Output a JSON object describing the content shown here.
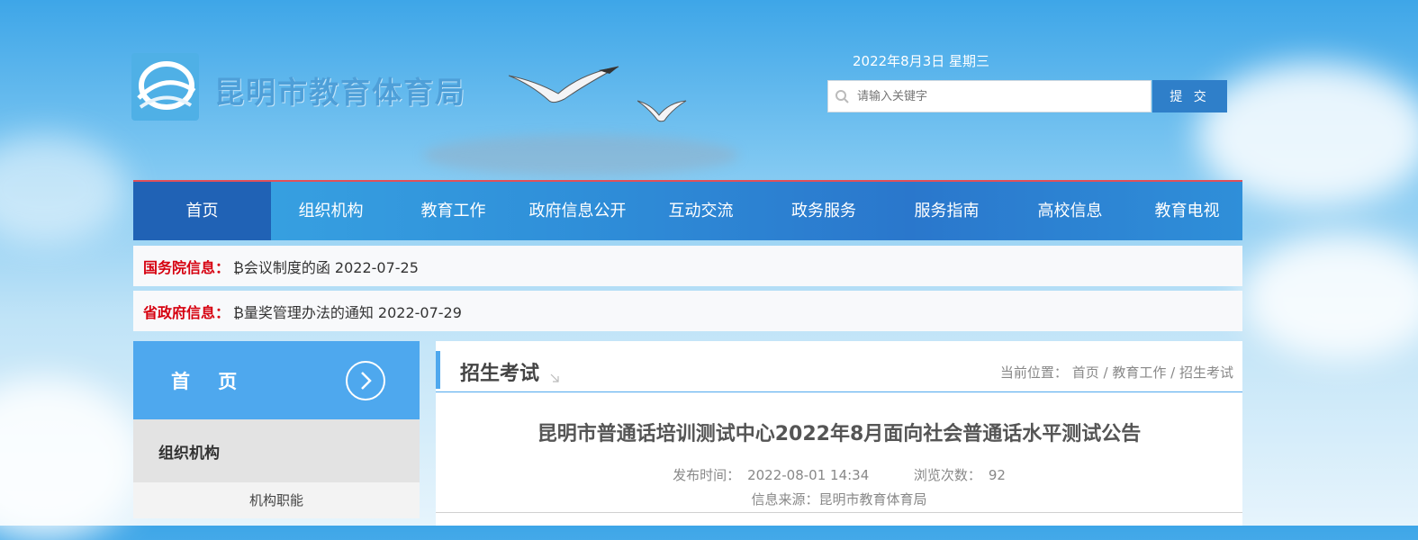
{
  "header": {
    "site_title": "昆明市教育体育局",
    "date": "2022年8月3日 星期三",
    "search": {
      "placeholder": "请输入关键字",
      "submit_label": "提 交"
    }
  },
  "nav": {
    "items": [
      {
        "label": "首页",
        "active": true
      },
      {
        "label": "组织机构"
      },
      {
        "label": "教育工作"
      },
      {
        "label": "政府信息公开"
      },
      {
        "label": "互动交流"
      },
      {
        "label": "政务服务"
      },
      {
        "label": "服务指南"
      },
      {
        "label": "高校信息"
      },
      {
        "label": "教育电视"
      }
    ]
  },
  "info_bars": [
    {
      "label": "国务院信息：",
      "text": "₿会议制度的函  2022-07-25"
    },
    {
      "label": "省政府信息：",
      "text": "₿量奖管理办法的通知  2022-07-29"
    }
  ],
  "sidebar": {
    "home_label": "首 页",
    "section_label": "组织机构",
    "sub_items": [
      "机构职能"
    ]
  },
  "main": {
    "section_title": "招生考试",
    "breadcrumb": {
      "prefix": "当前位置：",
      "items": [
        "首页",
        "教育工作",
        "招生考试"
      ],
      "sep": "/"
    },
    "article": {
      "title": "昆明市普通话培训测试中心2022年8月面向社会普通话水平测试公告",
      "publish_label": "发布时间：",
      "publish_time": "2022-08-01 14:34",
      "views_label": "浏览次数：",
      "views": "92",
      "source_label": "信息来源：",
      "source": "昆明市教育体育局"
    }
  }
}
